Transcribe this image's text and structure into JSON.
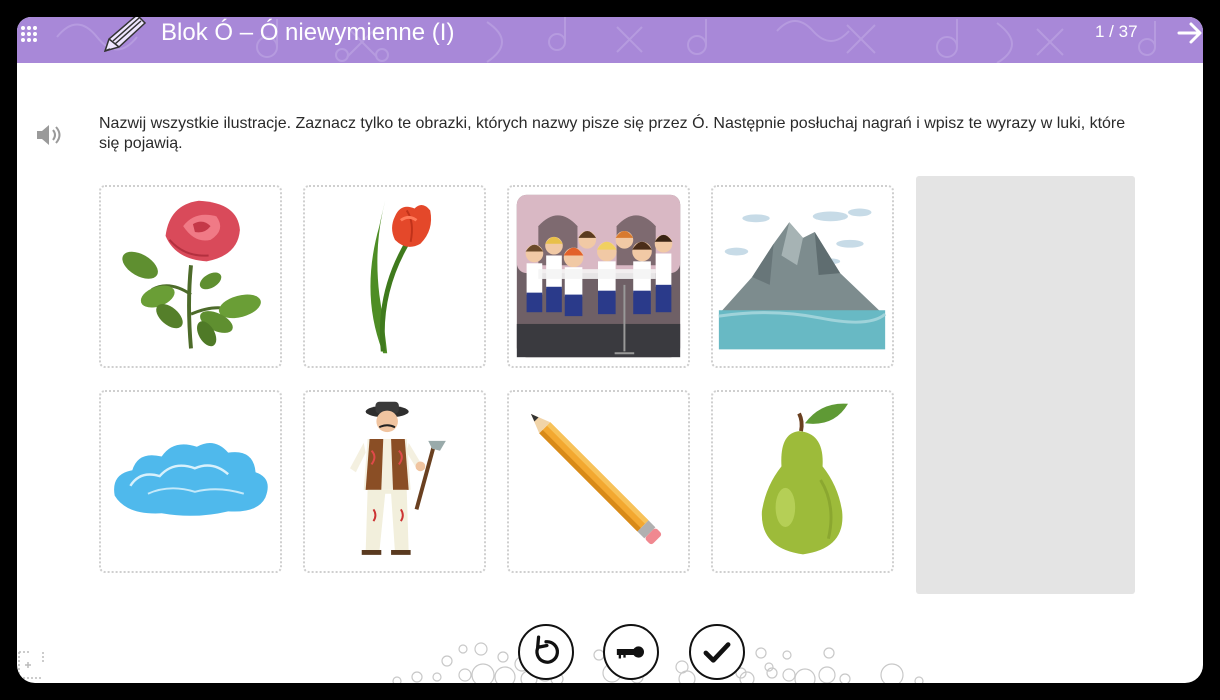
{
  "header": {
    "title": "Blok Ó – Ó niewymienne (I)",
    "page_counter": "1 / 37",
    "background_color": "#a888d8",
    "icons": [
      "grid-menu-icon",
      "pen-logo-icon",
      "arrow-right-icon"
    ]
  },
  "exercise": {
    "instruction": "Nazwij wszystkie ilustracje. Zaznacz tylko te obrazki, których nazwy pisze się przez Ó. Następnie posłuchaj nagrań i wpisz te wyrazy w luki, które się pojawią.",
    "audio_icon": "speaker-icon",
    "tiles": [
      {
        "picture": "rose"
      },
      {
        "picture": "tulip"
      },
      {
        "picture": "choir"
      },
      {
        "picture": "mountain"
      },
      {
        "picture": "cloud"
      },
      {
        "picture": "highlander"
      },
      {
        "picture": "pencil"
      },
      {
        "picture": "pear"
      }
    ]
  },
  "controls": {
    "icons": [
      "reset-icon",
      "key-icon",
      "check-icon",
      "fullscreen-icon"
    ]
  }
}
